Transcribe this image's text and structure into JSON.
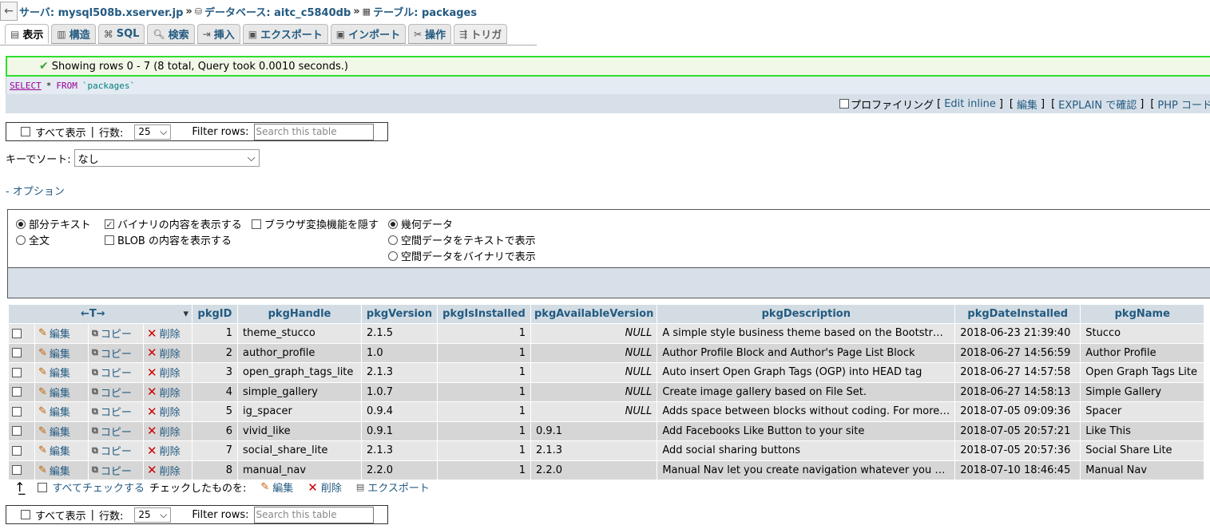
{
  "breadcrumb": {
    "server": "サーバ: mysql508b.xserver.jp",
    "database": "データベース: aitc_c5840db",
    "table": "テーブル: packages",
    "sep": "»"
  },
  "tabs": [
    {
      "label": "表示",
      "icon": "browse-icon"
    },
    {
      "label": "構造",
      "icon": "structure-icon"
    },
    {
      "label": "SQL",
      "icon": "sql-icon"
    },
    {
      "label": "検索",
      "icon": "search-icon"
    },
    {
      "label": "挿入",
      "icon": "insert-icon"
    },
    {
      "label": "エクスポート",
      "icon": "export-icon"
    },
    {
      "label": "インポート",
      "icon": "import-icon"
    },
    {
      "label": "操作",
      "icon": "operations-icon"
    },
    {
      "label": "トリガ",
      "icon": "triggers-icon"
    }
  ],
  "message": "Showing rows 0 - 7 (8 total, Query took 0.0010 seconds.)",
  "sql": {
    "select": "SELECT",
    "star": "*",
    "from": "FROM",
    "table": "`packages`"
  },
  "sqltools": {
    "profiling": "プロファイリング",
    "edit_inline": "Edit inline",
    "edit": "編集",
    "explain": "EXPLAIN で確認",
    "php": "PHP コード"
  },
  "nav": {
    "show_all": "すべて表示",
    "rows_label": "行数:",
    "rows_value": "25",
    "filter_label": "Filter rows:",
    "filter_placeholder": "Search this table"
  },
  "sort": {
    "label": "キーでソート:",
    "value": "なし"
  },
  "options_link": "- オプション",
  "options": {
    "partial_text": "部分テキスト",
    "full_text": "全文",
    "show_binary": "バイナリの内容を表示する",
    "show_blob": "BLOB の内容を表示する",
    "hide_browser_transform": "ブラウザ変換機能を隠す",
    "geometry": "幾何データ",
    "spatial_text": "空間データをテキストで表示",
    "spatial_binary": "空間データをバイナリで表示"
  },
  "table": {
    "col_toggle": "←T→",
    "columns": [
      "pkgID",
      "pkgHandle",
      "pkgVersion",
      "pkgIsInstalled",
      "pkgAvailableVersion",
      "pkgDescription",
      "pkgDateInstalled",
      "pkgName"
    ],
    "actions": {
      "edit": "編集",
      "copy": "コピー",
      "delete": "削除"
    },
    "rows": [
      {
        "id": "1",
        "handle": "theme_stucco",
        "version": "2.1.5",
        "installed": "1",
        "available": "NULL",
        "description": "A simple style business theme based on the Bootstr…",
        "date": "2018-06-23 21:39:40",
        "name": "Stucco"
      },
      {
        "id": "2",
        "handle": "author_profile",
        "version": "1.0",
        "installed": "1",
        "available": "NULL",
        "description": "Author Profile Block and Author's Page List Block",
        "date": "2018-06-27 14:56:59",
        "name": "Author Profile"
      },
      {
        "id": "3",
        "handle": "open_graph_tags_lite",
        "version": "2.1.3",
        "installed": "1",
        "available": "NULL",
        "description": "Auto insert Open Graph Tags (OGP) into HEAD tag",
        "date": "2018-06-27 14:57:58",
        "name": "Open Graph Tags Lite"
      },
      {
        "id": "4",
        "handle": "simple_gallery",
        "version": "1.0.7",
        "installed": "1",
        "available": "NULL",
        "description": "Create image gallery based on File Set.",
        "date": "2018-06-27 14:58:13",
        "name": "Simple Gallery"
      },
      {
        "id": "5",
        "handle": "ig_spacer",
        "version": "0.9.4",
        "installed": "1",
        "available": "NULL",
        "description": "Adds space between blocks without coding. For more…",
        "date": "2018-07-05 09:09:36",
        "name": "Spacer"
      },
      {
        "id": "6",
        "handle": "vivid_like",
        "version": "0.9.1",
        "installed": "1",
        "available": "0.9.1",
        "description": "Add Facebooks Like Button to your site",
        "date": "2018-07-05 20:57:21",
        "name": "Like This"
      },
      {
        "id": "7",
        "handle": "social_share_lite",
        "version": "2.1.3",
        "installed": "1",
        "available": "2.1.3",
        "description": "Add social sharing buttons",
        "date": "2018-07-05 20:57:36",
        "name": "Social Share Lite"
      },
      {
        "id": "8",
        "handle": "manual_nav",
        "version": "2.2.0",
        "installed": "1",
        "available": "2.2.0",
        "description": "Manual Nav let you create navigation whatever you …",
        "date": "2018-07-10 18:46:45",
        "name": "Manual Nav"
      }
    ]
  },
  "bulk": {
    "check_all": "すべてチェックする",
    "with_selected": "チェックしたものを:",
    "edit": "編集",
    "delete": "削除",
    "export": "エクスポート"
  }
}
